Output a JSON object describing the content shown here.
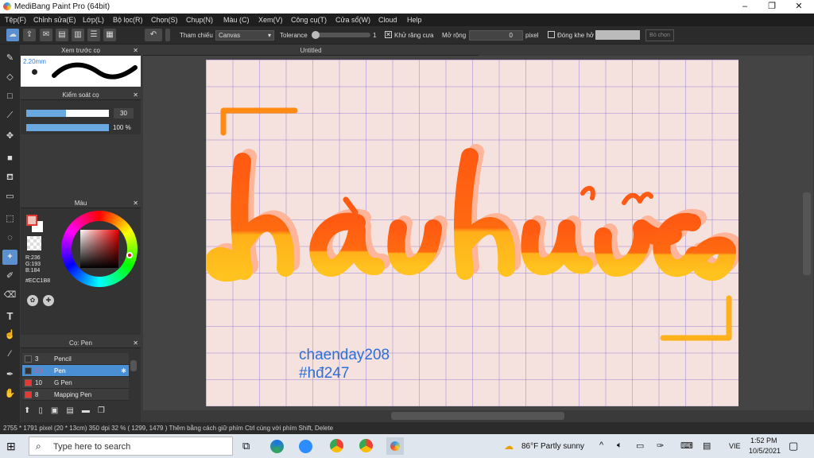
{
  "window": {
    "title": "MediBang Paint Pro (64bit)",
    "min": "–",
    "max": "❐",
    "close": "✕"
  },
  "menu": [
    "Tệp(F)",
    "Chỉnh sửa(E)",
    "Lớp(L)",
    "Bộ lọc(R)",
    "Chọn(S)",
    "Chụp(N)",
    "Màu (C)",
    "Xem(V)",
    "Công cụ(T)",
    "Cửa sổ(W)",
    "Cloud",
    "Help"
  ],
  "toolbar": {
    "reference_label": "Tham chiếu",
    "reference_value": "Canvas",
    "tolerance_label": "Tolerance",
    "tolerance_value": "1",
    "antialias_label": "Khử răng cưa",
    "expand_label": "Mở rộng",
    "expand_value": "0",
    "expand_unit": "pixel",
    "close_gap_label": "Đóng khe hở",
    "deselect_label": "Bỏ chọn"
  },
  "tabs": {
    "canvas_tab": "Untitled"
  },
  "brush_preview": {
    "title": "Xem trước cọ",
    "size": "2.20mm"
  },
  "brush_control": {
    "title": "Kiểm soát cọ",
    "size_value": "30",
    "opacity_value": "100 %",
    "size_fraction": 0.48,
    "opacity_fraction": 1.0
  },
  "color": {
    "title": "Màu",
    "r": "R:236",
    "g": "G:193",
    "b": "B:184",
    "hex": "#ECC1B8",
    "fg": "#ECC1B8",
    "bg": "#ffffff"
  },
  "brushes": {
    "title": "Cọ: Pen",
    "items": [
      {
        "size": "3",
        "name": "Pencil",
        "color": "#333333",
        "selected": false
      },
      {
        "size": "30",
        "name": "Pen",
        "color": "#333333",
        "selected": true
      },
      {
        "size": "10",
        "name": "G Pen",
        "color": "#e53935",
        "selected": false
      },
      {
        "size": "8",
        "name": "Mapping Pen",
        "color": "#e53935",
        "selected": false
      }
    ]
  },
  "canvas_text": {
    "line1": "chaenday208",
    "line2": "#hđ247"
  },
  "status": "2755 * 1791 pixel   (20 * 13cm)   350 dpi   32 %   ( 1299, 1479 )   Thêm bằng cách giữ phím Ctrl cùng với phím Shift, Delete",
  "taskbar": {
    "search_placeholder": "Type here to search",
    "weather": "86°F  Partly sunny",
    "lang": "VIE",
    "time": "1:52 PM",
    "date": "10/5/2021"
  }
}
